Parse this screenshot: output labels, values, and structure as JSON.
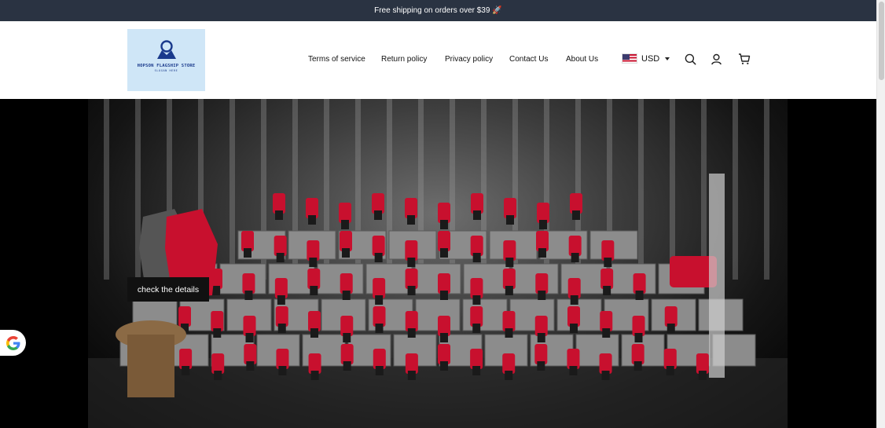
{
  "announcement": {
    "text": "Free shipping on orders over $39",
    "emoji": "🚀"
  },
  "logo": {
    "brand": "HOPSON FLAGSHIP STORE",
    "slogan": "SLOGAN HERE"
  },
  "nav": [
    {
      "label": "Terms of service"
    },
    {
      "label": "Return policy"
    },
    {
      "label": "Privacy policy"
    },
    {
      "label": "Contact Us"
    },
    {
      "label": "About Us"
    }
  ],
  "currency": {
    "code": "USD",
    "flag": "us-flag"
  },
  "header_icons": [
    "search-icon",
    "account-icon",
    "cart-icon"
  ],
  "hero": {
    "cta_label": "check the details"
  },
  "colors": {
    "announcement_bg": "#2a3342",
    "tool_red": "#c8102e",
    "cta_bg": "#111111",
    "logo_bg": "#cfe6f7"
  }
}
